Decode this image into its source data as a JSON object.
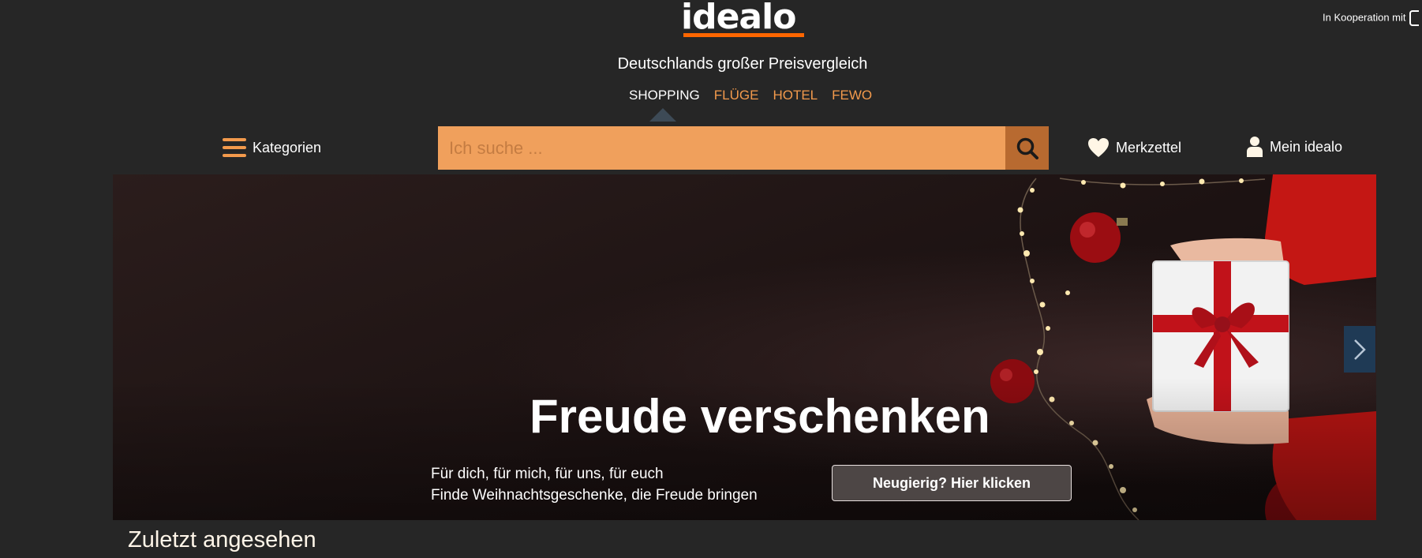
{
  "header": {
    "logo_text": "idealo",
    "cooperation_text": "In Kooperation mit",
    "tagline": "Deutschlands großer Preisvergleich",
    "verticals": [
      "SHOPPING",
      "FLÜGE",
      "HOTEL",
      "FEWO"
    ],
    "active_vertical": "SHOPPING"
  },
  "toolbar": {
    "categories_label": "Kategorien",
    "search_placeholder": "Ich suche ...",
    "wishlist_label": "Merkzettel",
    "account_label": "Mein idealo"
  },
  "hero": {
    "title": "Freude verschenken",
    "subtitle_line1": "Für dich, für mich, für uns, für euch",
    "subtitle_line2": "Finde Weihnachtsgeschenke, die Freude bringen",
    "cta_label": "Neugierig? Hier klicken"
  },
  "recent": {
    "title": "Zuletzt angesehen"
  },
  "colors": {
    "background": "#262626",
    "accent_orange": "#f39a4c",
    "search_bg": "#f0a05c",
    "search_button": "#b86a30",
    "logo_underline": "#ff6600",
    "slider_next_bg": "#1f3a55"
  },
  "icons": [
    "menu-icon",
    "search-icon",
    "heart-icon",
    "user-icon",
    "chevron-right-icon"
  ]
}
